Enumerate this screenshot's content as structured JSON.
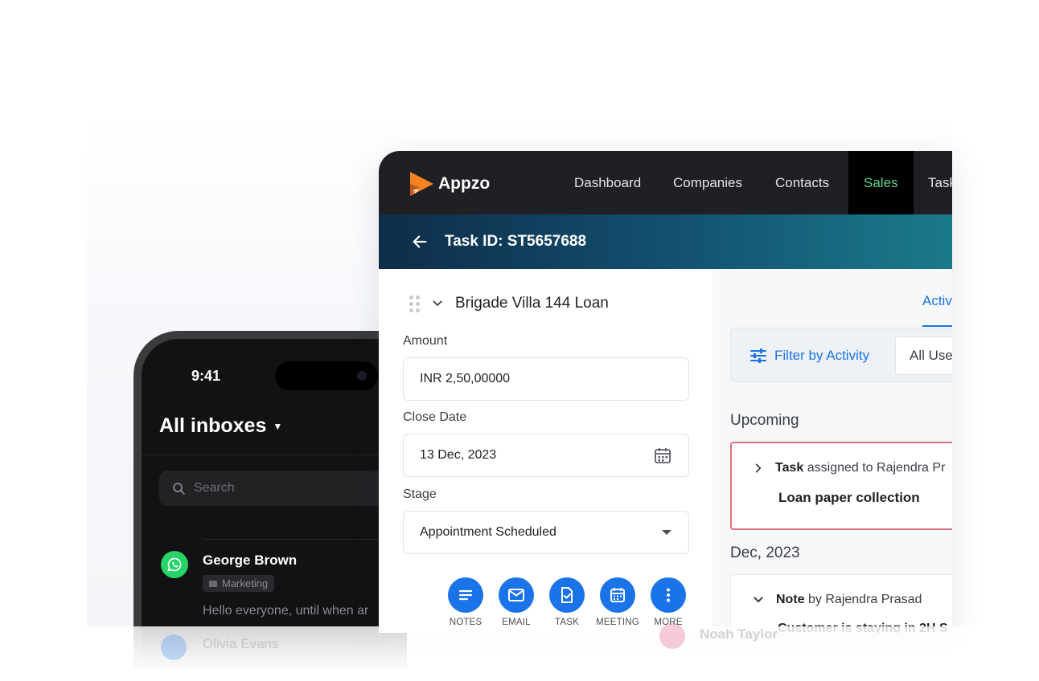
{
  "phone": {
    "time": "9:41",
    "inbox_title": "All inboxes",
    "search_placeholder": "Search",
    "conversation": {
      "name": "George Brown",
      "tag": "Marketing",
      "message": "Hello everyone, until when ar"
    },
    "next_conversation_name": "Olivia Evans"
  },
  "app": {
    "brand": "Appzo",
    "nav": [
      "Dashboard",
      "Companies",
      "Contacts",
      "Sales",
      "Task"
    ],
    "active_nav": "Sales",
    "task_title": "Task ID: ST5657688",
    "deal": {
      "title": "Brigade Villa 144 Loan",
      "amount_label": "Amount",
      "amount_value": "INR 2,50,00000",
      "close_date_label": "Close Date",
      "close_date_value": "13 Dec, 2023",
      "stage_label": "Stage",
      "stage_value": "Appointment Scheduled"
    },
    "actions": [
      "NOTES",
      "EMAIL",
      "TASK",
      "MEETING",
      "MORE"
    ],
    "activity": {
      "tab": "Activi",
      "filter_label": "Filter by Activity",
      "users_select": "All Use",
      "upcoming_heading": "Upcoming",
      "upcoming_item": {
        "type": "Task",
        "assignment": "assigned to Rajendra Pr",
        "title": "Loan paper collection"
      },
      "month_heading": "Dec, 2023",
      "note_item": {
        "type": "Note",
        "author": "by Rajendra Prasad",
        "title": "Customer is staying in 2H S"
      },
      "ghost_contact": "Noah Taylor"
    }
  },
  "colors": {
    "accent": "#1a73e8",
    "nav_active": "#5ed38e",
    "upcoming_border": "#e0707b",
    "logo_orange": "#f58220"
  }
}
